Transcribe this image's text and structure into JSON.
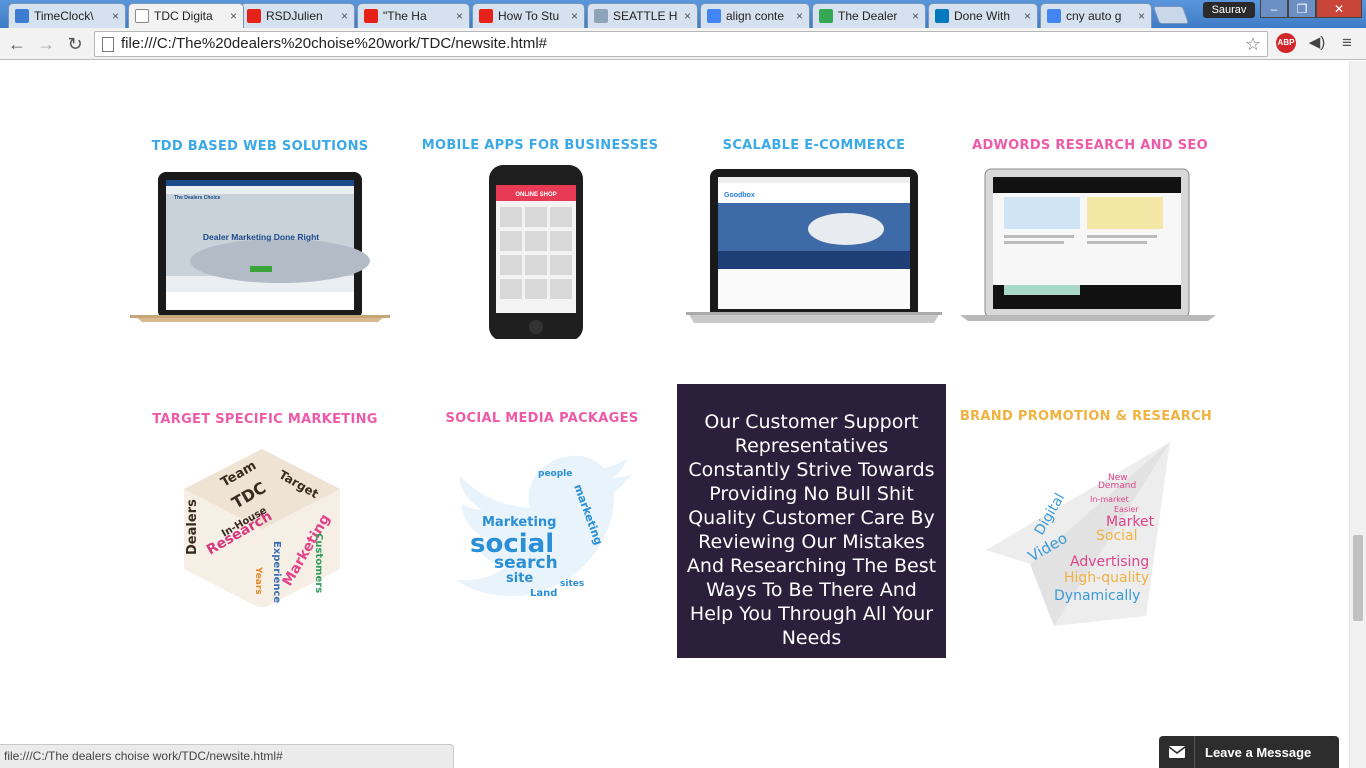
{
  "browser": {
    "tabs": [
      {
        "label": "TimeClock\\",
        "icon": "globe-icon",
        "color": "#3b7bd1"
      },
      {
        "label": "TDC Digita",
        "icon": "page-icon",
        "color": "#ffffff",
        "active": true
      },
      {
        "label": "RSDJulien",
        "icon": "youtube-icon",
        "color": "#e62117"
      },
      {
        "label": "\"The Ha",
        "icon": "youtube-icon",
        "color": "#e62117"
      },
      {
        "label": "How To Stu",
        "icon": "youtube-icon",
        "color": "#e62117"
      },
      {
        "label": "SEATTLE H",
        "icon": "s-icon",
        "color": "#8fa3b8"
      },
      {
        "label": "align conte",
        "icon": "google-icon",
        "color": "#4285f4"
      },
      {
        "label": "The Dealer",
        "icon": "maps-icon",
        "color": "#34a853"
      },
      {
        "label": "Done With",
        "icon": "trello-icon",
        "color": "#0079bf"
      },
      {
        "label": "cny auto g",
        "icon": "google-icon",
        "color": "#4285f4"
      }
    ],
    "user": "Saurav",
    "url": "file:///C:/The%20dealers%20choise%20work/TDC/newsite.html#",
    "status_url": "file:///C:/The dealers choise work/TDC/newsite.html#"
  },
  "services": {
    "row1": [
      {
        "title": "TDD BASED WEB SOLUTIONS",
        "color": "blue",
        "device": "laptop-gold"
      },
      {
        "title": "MOBILE APPS FOR BUSINESSES",
        "color": "blue",
        "device": "phone"
      },
      {
        "title": "SCALABLE E-COMMERCE",
        "color": "blue",
        "device": "laptop-silver"
      },
      {
        "title": "ADWORDS RESEARCH AND SEO",
        "color": "pink",
        "device": "laptop-air"
      }
    ],
    "row2": [
      {
        "title": "TARGET SPECIFIC MARKETING",
        "color": "pink"
      },
      {
        "title": "SOCIAL MEDIA PACKAGES",
        "color": "pink"
      },
      {
        "title": "BRAND PROMOTION & RESEARCH",
        "color": "orange"
      }
    ]
  },
  "mockups": {
    "laptop1_heading": "Dealer Marketing Done Right",
    "laptop1_logo": "The Dealers Choice",
    "phone_header": "ONLINE SHOP",
    "laptop3_logo": "Goodbox"
  },
  "promo_text": "Our Customer Support Representatives Constantly Strive Towards Providing No Bull Shit Quality Customer Care By Reviewing Our Mistakes And Researching The Best Ways To Be There And Help You Through All Your Needs",
  "chat": {
    "label": "Leave a Message",
    "icon": "mail-icon"
  },
  "colors": {
    "blue": "#3aa9e6",
    "pink": "#ee5aa7",
    "orange": "#f0b240",
    "promo_bg": "#2c1f3b"
  }
}
